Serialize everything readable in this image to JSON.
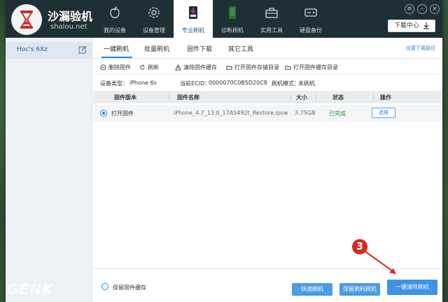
{
  "app": {
    "name": "沙漏验机",
    "url": "shalou.net"
  },
  "nav": {
    "items": [
      {
        "label": "我的设备",
        "icon": "apple-icon"
      },
      {
        "label": "设备管理",
        "icon": "gear-icon"
      },
      {
        "label": "专业刷机",
        "icon": "flash-icon",
        "active": true
      },
      {
        "label": "诊断刷机",
        "icon": "diagnose-icon"
      },
      {
        "label": "实用工具",
        "icon": "toolbox-icon"
      },
      {
        "label": "硬盘备份",
        "icon": "disk-icon"
      }
    ],
    "download_center": "下载中心"
  },
  "sidebar": {
    "device_name": "Hoc's 6Xz"
  },
  "tabs": [
    {
      "label": "一键刷机",
      "active": true
    },
    {
      "label": "批量刷机"
    },
    {
      "label": "固件下载"
    },
    {
      "label": "其它工具"
    }
  ],
  "settings_link": "设置下载路径",
  "toolbar": {
    "delete": "删除固件",
    "refresh": "刷新",
    "clear_cache": "清除固件缓存",
    "open_storage": "打开固件存储目录",
    "open_cache": "打开固件缓存目录"
  },
  "info": {
    "device_type_label": "设备类型：",
    "device_type": "iPhone 6s",
    "ecid_label": "当前ECID：",
    "ecid": "0000070C0B5D20C8",
    "mode_label": "刷机模式：",
    "mode": "未刷机"
  },
  "table": {
    "headers": [
      "固件版本",
      "固件名称",
      "大小",
      "状态",
      "操作"
    ],
    "row": {
      "version": "打开固件",
      "name": "iPhone_4.7_13.0_17A5492t_Restore.ipsw",
      "size": "3.75GB",
      "status": "已完成",
      "action": "选择"
    }
  },
  "bottom": {
    "keep_cache": "保留固件缓存",
    "quick_flash": "快速刷机",
    "keep_data_flash": "保留资料刷机",
    "one_click_clear": "一键清除刷机"
  },
  "annotation": {
    "number": "3"
  },
  "watermark": "GENK",
  "colors": {
    "header_bg": "#1f2f36",
    "accent": "#1e88e5",
    "status_green": "#2a9a3a",
    "annotation_red": "#d42a1f"
  }
}
